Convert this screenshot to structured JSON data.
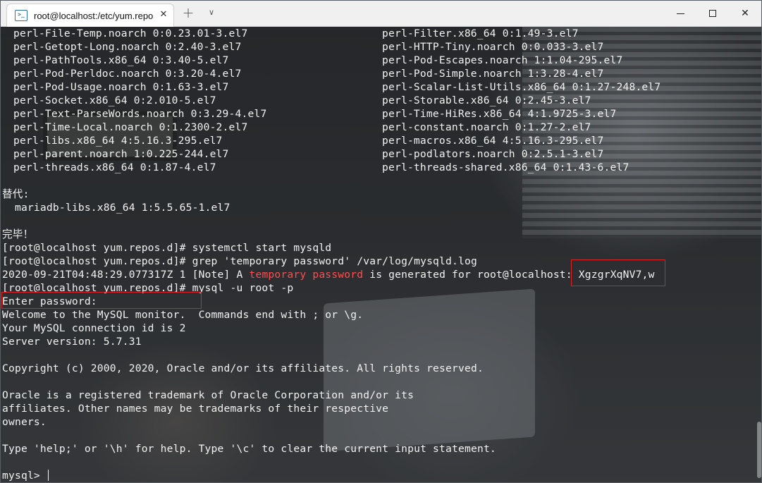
{
  "tab": {
    "title": "root@localhost:/etc/yum.repos.d",
    "icon": "terminal-icon",
    "close_glyph": "✕"
  },
  "titlebar": {
    "new_tab_glyph": "+",
    "menu_glyph": "∨",
    "close_glyph": "✕"
  },
  "colors": {
    "highlight": "#ff4d4d",
    "box": "#e02020",
    "text": "#f2f2f2"
  },
  "packages_col1": [
    "perl-File-Temp.noarch 0:0.23.01-3.el7",
    "perl-Getopt-Long.noarch 0:2.40-3.el7",
    "perl-PathTools.x86_64 0:3.40-5.el7",
    "perl-Pod-Perldoc.noarch 0:3.20-4.el7",
    "perl-Pod-Usage.noarch 0:1.63-3.el7",
    "perl-Socket.x86_64 0:2.010-5.el7",
    "perl-Text-ParseWords.noarch 0:3.29-4.el7",
    "perl-Time-Local.noarch 0:1.2300-2.el7",
    "perl-libs.x86_64 4:5.16.3-295.el7",
    "perl-parent.noarch 1:0.225-244.el7",
    "perl-threads.x86_64 0:1.87-4.el7"
  ],
  "packages_col2": [
    "perl-Filter.x86_64 0:1.49-3.el7",
    "perl-HTTP-Tiny.noarch 0:0.033-3.el7",
    "perl-Pod-Escapes.noarch 1:1.04-295.el7",
    "perl-Pod-Simple.noarch 1:3.28-4.el7",
    "perl-Scalar-List-Utils.x86_64 0:1.27-248.el7",
    "perl-Storable.x86_64 0:2.45-3.el7",
    "perl-Time-HiRes.x86_64 4:1.9725-3.el7",
    "perl-constant.noarch 0:1.27-2.el7",
    "perl-macros.x86_64 4:5.16.3-295.el7",
    "perl-podlators.noarch 0:2.5.1-3.el7",
    "perl-threads-shared.x86_64 0:1.43-6.el7"
  ],
  "replaced_header": "替代:",
  "replaced_pkg": "  mariadb-libs.x86_64 1:5.5.65-1.el7",
  "done": "完毕！",
  "cmd1": "[root@localhost yum.repos.d]# systemctl start mysqld",
  "cmd2": "[root@localhost yum.repos.d]# grep 'temporary password' /var/log/mysqld.log",
  "log_line": {
    "prefix": "2020-09-21T04:48:29.077317Z 1 [Note] A ",
    "highlight": "temporary password",
    "middle": " is generated for root@localhost: ",
    "password": "XgzgrXqNV7,w"
  },
  "cmd3": "[root@localhost yum.repos.d]# mysql -u root -p",
  "enter_password": "Enter password:",
  "welcome": "Welcome to the MySQL monitor.  Commands end with ; or \\g.",
  "conn_id": "Your MySQL connection id is 2",
  "server_version": "Server version: 5.7.31",
  "copyright": "Copyright (c) 2000, 2020, Oracle and/or its affiliates. All rights reserved.",
  "trademark": [
    "Oracle is a registered trademark of Oracle Corporation and/or its",
    "affiliates. Other names may be trademarks of their respective",
    "owners."
  ],
  "help": "Type 'help;' or '\\h' for help. Type '\\c' to clear the current input statement.",
  "prompt": "mysql> "
}
